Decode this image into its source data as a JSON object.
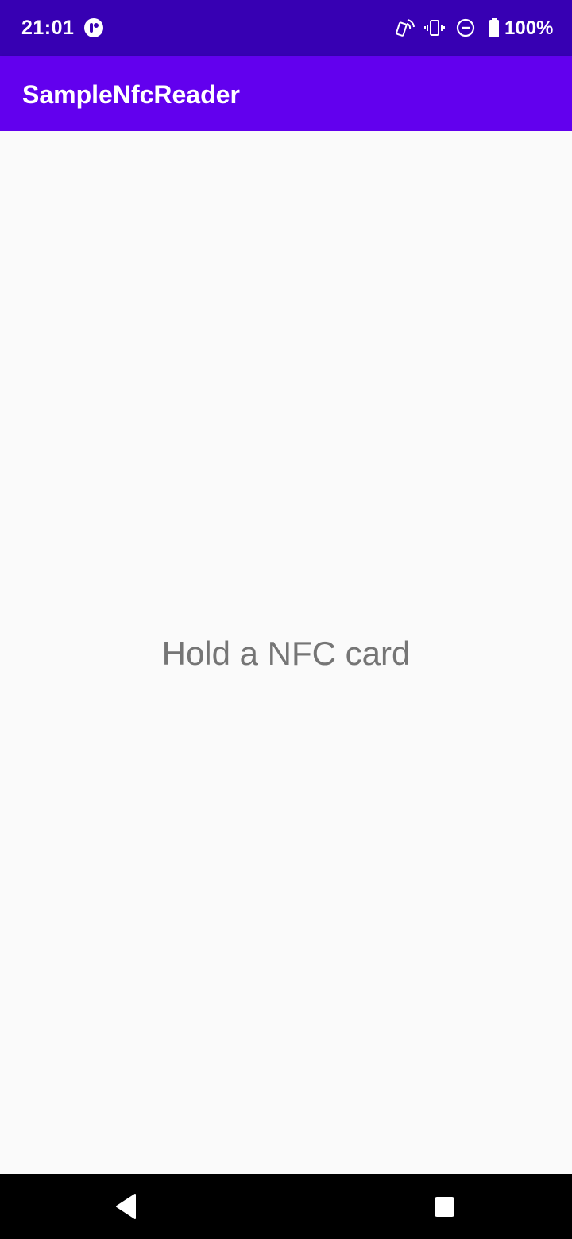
{
  "status_bar": {
    "time": "21:01",
    "battery_percent": "100%",
    "icons": [
      "notification-app-icon",
      "nfc-icon",
      "vibrate-icon",
      "do-not-disturb-icon",
      "battery-full-icon"
    ],
    "background_color": "#3700B3"
  },
  "app_bar": {
    "title": "SampleNfcReader",
    "background_color": "#6200EE"
  },
  "main": {
    "message": "Hold a NFC card"
  },
  "nav_bar": {
    "buttons": [
      "back-button",
      "recents-button"
    ]
  }
}
